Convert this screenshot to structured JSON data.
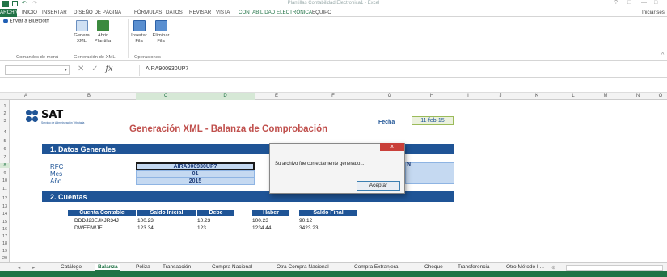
{
  "window": {
    "title": "Plantillas Contabilidad Electronica1 - Excel",
    "controls": [
      "?",
      "□",
      "—",
      "□"
    ],
    "user": "Iniciar ses"
  },
  "ribbon_tabs": [
    "ARCHIVO",
    "INICIO",
    "INSERTAR",
    "DISEÑO DE PÁGINA",
    "FÓRMULAS",
    "DATOS",
    "REVISAR",
    "VISTA",
    "CONTABILIDAD ELECTRÓNICA",
    "EQUIPO"
  ],
  "ribbon": {
    "menu_button": "Enviar a Bluetooth",
    "buttons": [
      {
        "label": "Genera XML",
        "icon": "xml-icon"
      },
      {
        "label": "Abrir Plantilla",
        "icon": "open-template-icon"
      },
      {
        "label": "Insertar Fila",
        "icon": "insert-row-icon"
      },
      {
        "label": "Eliminar Fila",
        "icon": "delete-row-icon"
      }
    ],
    "groups": [
      "Comandos de menú",
      "Generación de XML",
      "Operaciones"
    ]
  },
  "formula_bar": {
    "value": "AIRA900930UP7",
    "fx": "fx"
  },
  "columns": [
    "A",
    "B",
    "C",
    "D",
    "E",
    "F",
    "G",
    "H",
    "I",
    "J",
    "K",
    "L",
    "M",
    "N",
    "O"
  ],
  "rows": [
    "1",
    "2",
    "3",
    "4",
    "5",
    "6",
    "7",
    "8",
    "9",
    "10",
    "11",
    "12",
    "13",
    "14",
    "15",
    "16",
    "17",
    "18",
    "19",
    "20"
  ],
  "sheet": {
    "logo_text": "SAT",
    "logo_sub": "Servicio de Administración Tributaria",
    "title": "Generación XML - Balanza de Comprobación",
    "fecha_label": "Fecha",
    "fecha_value": "11-feb-15",
    "section1": "1. Datos Generales",
    "rfc_label": "RFC",
    "rfc_value": "AIRA900930UP7",
    "mes_label": "Mes",
    "mes_value": "01",
    "anio_label": "Año",
    "anio_value": "2015",
    "hidden_letter": "N",
    "section2": "2. Cuentas",
    "table_headers": [
      "Cuenta Contable",
      "Saldo Inicial",
      "Debe",
      "Haber",
      "Saldo Final"
    ],
    "table_rows": [
      [
        "DDDJ23EJKJR34J",
        "100.23",
        "10.23",
        "100.23",
        "90.12"
      ],
      [
        "DWEFIWJE",
        "123.34",
        "123",
        "1234.44",
        "3423.23"
      ]
    ]
  },
  "dialog": {
    "close": "x",
    "message": "Su archivo fue correctamente generado...",
    "ok": "Aceptar"
  },
  "sheet_tabs": [
    "Catálogo",
    "Balanza",
    "Póliza",
    "Transacción",
    "Compra Nacional",
    "Otra Compra Nacional",
    "Compra Extranjera",
    "Cheque",
    "Transferencia",
    "Otro Método I ..."
  ],
  "colors": {
    "excel_green": "#217346",
    "sat_blue": "#1f5496",
    "cell_fill": "#c5d9f1",
    "title_red": "#c0504d"
  }
}
